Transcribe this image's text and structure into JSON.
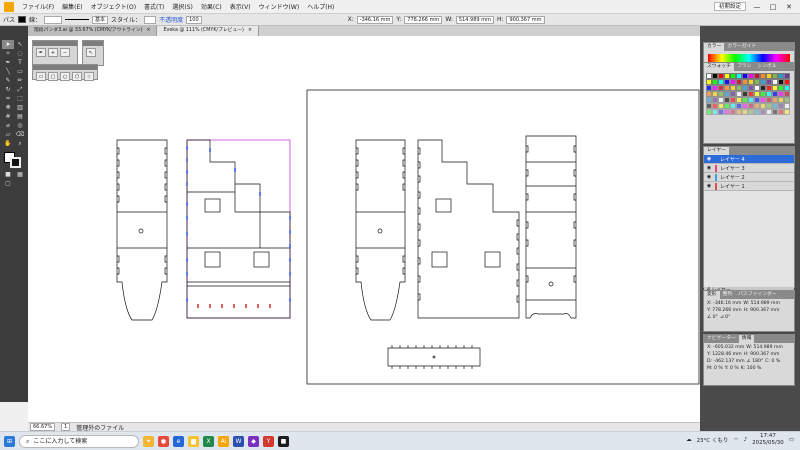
{
  "menubar": {
    "items": [
      "ファイル(F)",
      "編集(E)",
      "オブジェクト(O)",
      "書式(T)",
      "選択(S)",
      "効果(C)",
      "表示(V)",
      "ウィンドウ(W)",
      "ヘルプ(H)"
    ],
    "workspace": "初期設定",
    "win_min": "—",
    "win_max": "□",
    "win_close": "✕"
  },
  "controlbar": {
    "label": "パス",
    "stroke_label": "線：",
    "stroke_style": "基本",
    "style_label": "スタイル：",
    "opacity_label": "不透明度",
    "opacity_value": "100",
    "x": "-346.16 mm",
    "y": "778.266 mm",
    "w": "514.989 mm",
    "h": "900.367 mm"
  },
  "tabs": [
    {
      "name": "階段パンダ3.ai @ 33.67% (CMYK/アウトライン)",
      "close": "×",
      "active": false
    },
    {
      "name": "Eveka @ 111% (CMYK/プレビュー)",
      "close": "×",
      "active": true
    }
  ],
  "statusbar": {
    "zoom": "66.67%",
    "page": "1",
    "status": "管理外のファイル"
  },
  "panels": {
    "color_tabs": [
      "カラー",
      "カラーガイド"
    ],
    "swatch_tabs": [
      "スウォッチ",
      "ブラシ",
      "シンボル"
    ],
    "layer_tab": "レイヤー",
    "layers": [
      {
        "name": "レイヤー 4",
        "color": "#2d6bd8",
        "active": true
      },
      {
        "name": "レイヤー 3",
        "color": "#e0457b",
        "active": false
      },
      {
        "name": "レイヤー 2",
        "color": "#36a3e0",
        "active": false
      },
      {
        "name": "レイヤー 1",
        "color": "#e04a4a",
        "active": false
      }
    ],
    "layer_count": "4 レイヤー",
    "transform_tabs": [
      "変形",
      "整列",
      "パスファインダー"
    ],
    "transform": {
      "x": "-346.16 mm",
      "y": "778.266 mm",
      "w": "514.989 mm",
      "h": "900.367 mm",
      "angle": "0°",
      "shear": "0°"
    },
    "info_tabs": [
      "ナビゲーター",
      "情報"
    ],
    "info": {
      "x": "-605.032 mm",
      "y": "1228.46 mm",
      "w": "514.989 mm",
      "h": "900.367 mm",
      "d": "-462.137 mm",
      "angle": "180°",
      "c": "0 %",
      "m": "0 %",
      "yv": "0 %",
      "k": "100 %"
    }
  },
  "taskbar": {
    "search_placeholder": "ここに入力して検索",
    "weather": "23°C くもり",
    "time": "17:47",
    "date": "2025/05/30"
  },
  "colors": {
    "selection": "#c43bd6",
    "anchor_blue": "#3a5bd9",
    "anchor_red": "#d93a3a",
    "toolbar": "#3c3c3c",
    "panel_bg": "#4a4a4a",
    "layer_active": "#2d6bd8"
  }
}
